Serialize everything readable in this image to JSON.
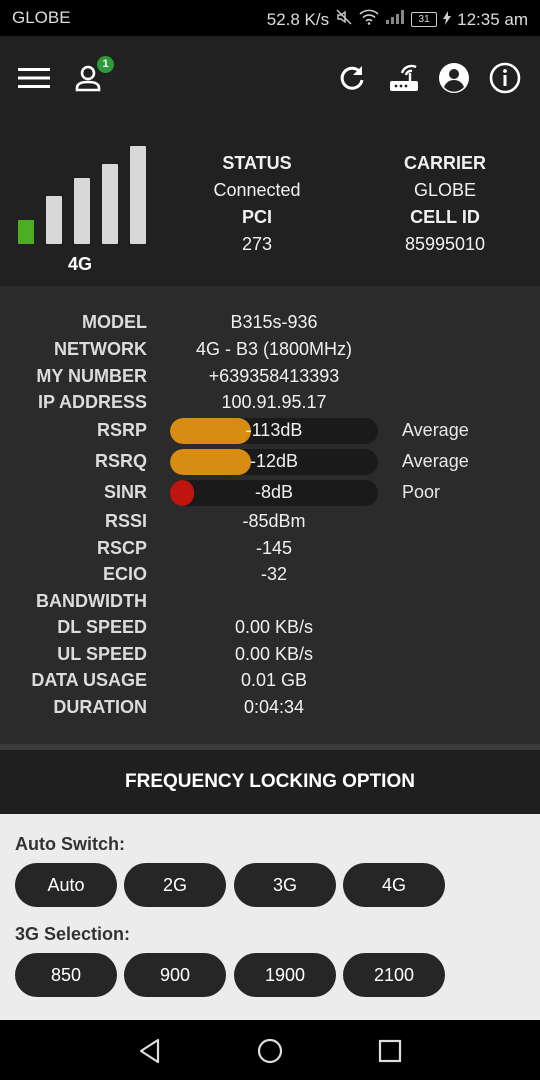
{
  "statusbar": {
    "carrier": "GLOBE",
    "speed": "52.8 K/s",
    "battery": "31",
    "time": "12:35 am"
  },
  "appbar": {
    "badge_count": "1"
  },
  "summary": {
    "network_type": "4G",
    "signal_bars_active": 1,
    "signal_bars_total": 5,
    "status_label": "STATUS",
    "status_value": "Connected",
    "pci_label": "PCI",
    "pci_value": "273",
    "carrier_label": "CARRIER",
    "carrier_value": "GLOBE",
    "cellid_label": "CELL ID",
    "cellid_value": "85995010"
  },
  "details": {
    "model": {
      "label": "MODEL",
      "value": "B315s-936"
    },
    "network": {
      "label": "NETWORK",
      "value": "4G - B3 (1800MHz)"
    },
    "my_number": {
      "label": "MY NUMBER",
      "value": "+639358413393"
    },
    "ip_address": {
      "label": "IP ADDRESS",
      "value": "100.91.95.17"
    },
    "rsrp": {
      "label": "RSRP",
      "value": "-113dB",
      "quality": "Average",
      "level": 0.39,
      "color": "#d98c12"
    },
    "rsrq": {
      "label": "RSRQ",
      "value": "-12dB",
      "quality": "Average",
      "level": 0.39,
      "color": "#d98c12"
    },
    "sinr": {
      "label": "SINR",
      "value": "-8dB",
      "quality": "Poor",
      "level": 0.1,
      "color": "#c0150f"
    },
    "rssi": {
      "label": "RSSI",
      "value": "-85dBm"
    },
    "rscp": {
      "label": "RSCP",
      "value": "-145"
    },
    "ecio": {
      "label": "ECIO",
      "value": "-32"
    },
    "bandwidth": {
      "label": "BANDWIDTH",
      "value": ""
    },
    "dl_speed": {
      "label": "DL SPEED",
      "value": "0.00 KB/s"
    },
    "ul_speed": {
      "label": "UL SPEED",
      "value": "0.00 KB/s"
    },
    "data_usage": {
      "label": "DATA USAGE",
      "value": "0.01 GB"
    },
    "duration": {
      "label": "DURATION",
      "value": "0:04:34"
    }
  },
  "frequency_locking": {
    "title": "FREQUENCY LOCKING OPTION",
    "auto_switch_label": "Auto Switch:",
    "auto_switch_options": [
      "Auto",
      "2G",
      "3G",
      "4G"
    ],
    "selection_3g_label": "3G Selection:",
    "selection_3g_options": [
      "850",
      "900",
      "1900",
      "2100"
    ]
  },
  "colors": {
    "accent_green": "#2e9b3a",
    "signal_active": "#4caf22",
    "signal_inactive": "#d8d8d8",
    "meter_average": "#d98c12",
    "meter_poor": "#c0150f"
  }
}
